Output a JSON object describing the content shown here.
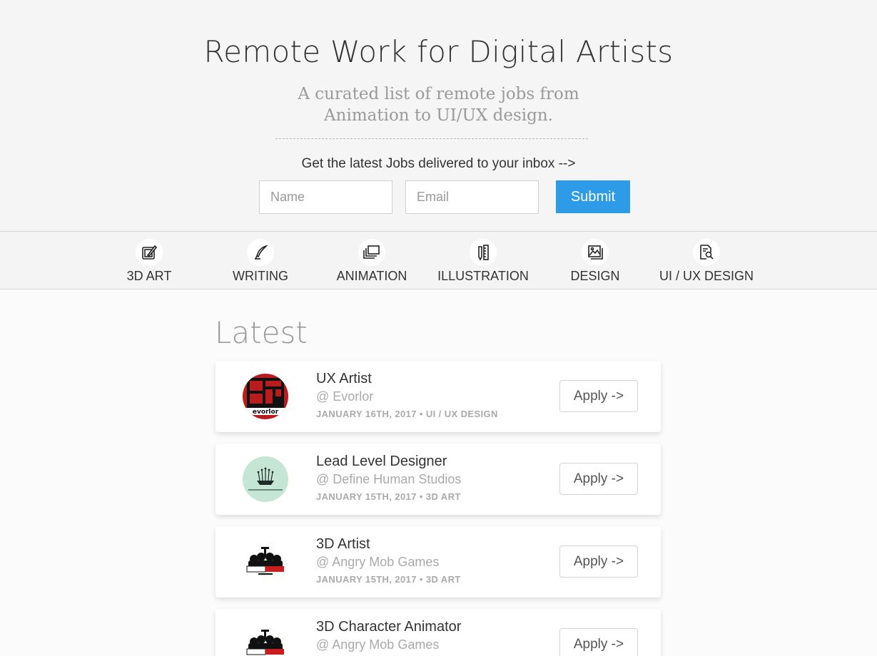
{
  "header": {
    "title": "Remote Work for Digital Artists",
    "subtitle_line1": "A curated list of remote jobs from",
    "subtitle_line2": "Animation to UI/UX design."
  },
  "signup": {
    "prompt": "Get the latest Jobs delivered to your inbox -->",
    "name_placeholder": "Name",
    "email_placeholder": "Email",
    "submit_label": "Submit",
    "accent_color": "#2d9be8"
  },
  "categories": [
    {
      "label": "3D ART",
      "icon": "tablet-pen-icon"
    },
    {
      "label": "WRITING",
      "icon": "quill-pen-icon"
    },
    {
      "label": "ANIMATION",
      "icon": "stacked-frames-icon"
    },
    {
      "label": "ILLUSTRATION",
      "icon": "pencil-ruler-icon"
    },
    {
      "label": "DESIGN",
      "icon": "image-gallery-icon"
    },
    {
      "label": "UI / UX DESIGN",
      "icon": "document-search-icon"
    }
  ],
  "latest": {
    "heading": "Latest",
    "jobs": [
      {
        "title": "UX Artist",
        "company": "@ Evorlor",
        "date": "JANUARY 16TH, 2017",
        "category": "UI / UX DESIGN",
        "apply_label": "Apply ->",
        "logo": "evorlor-logo"
      },
      {
        "title": "Lead Level Designer",
        "company": "@ Define Human Studios",
        "date": "JANUARY 15TH, 2017",
        "category": "3D ART",
        "apply_label": "Apply ->",
        "logo": "define-human-logo"
      },
      {
        "title": "3D Artist",
        "company": "@ Angry Mob Games",
        "date": "JANUARY 15TH, 2017",
        "category": "3D ART",
        "apply_label": "Apply ->",
        "logo": "angry-mob-logo"
      },
      {
        "title": "3D Character Animator",
        "company": "@ Angry Mob Games",
        "date": "",
        "category": "",
        "apply_label": "Apply ->",
        "logo": "angry-mob-logo"
      }
    ]
  }
}
